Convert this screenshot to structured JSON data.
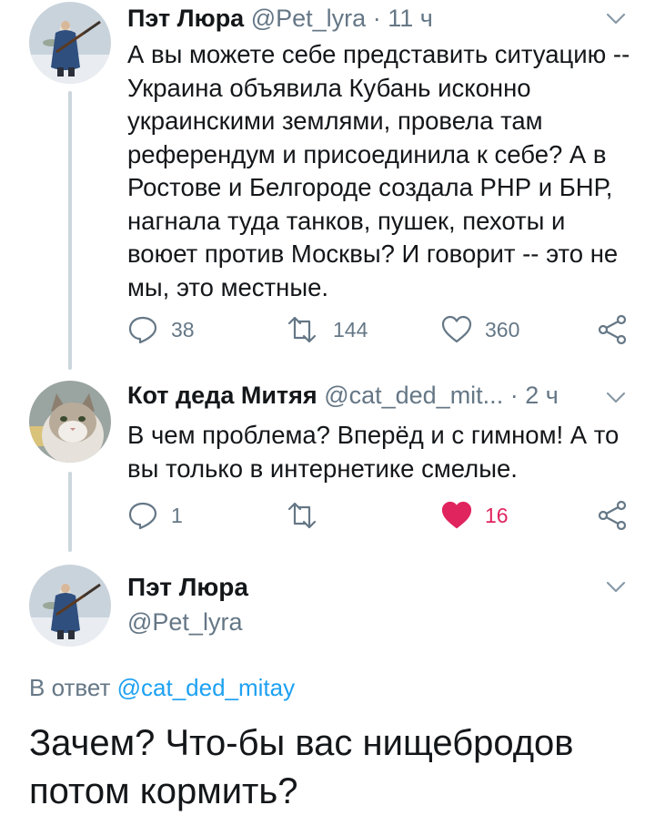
{
  "tweet1": {
    "name": "Пэт Люра",
    "handle": "@Pet_lyra",
    "sep": "·",
    "time": "11 ч",
    "text": "А вы можете себе представить ситуацию -- Украина объявила Кубань исконно украинскими землями, провела там референдум и присоединила к себе? А в Ростове и Белгороде создала РНР и БНР, нагнала туда танков, пушек, пехоты и воюет против Москвы? И говорит -- это не мы, это местные.",
    "replies": "38",
    "retweets": "144",
    "likes": "360",
    "liked": false
  },
  "tweet2": {
    "name": "Кот деда Митяя",
    "handle": "@cat_ded_mit...",
    "sep": "·",
    "time": "2 ч",
    "text": "В чем проблема? Вперёд и с гимном! А то вы только в интернетике смелые.",
    "replies": "1",
    "retweets": "",
    "likes": "16",
    "liked": true
  },
  "main_tweet": {
    "name": "Пэт Люра",
    "handle": "@Pet_lyra",
    "reply_prefix": "В ответ",
    "reply_mention": "@cat_ded_mitay",
    "text": "Зачем? Что-бы вас нищебродов потом кормить?"
  },
  "colors": {
    "text": "#14171a",
    "secondary": "#657786",
    "link": "#1da1f2",
    "like": "#e0245e",
    "thread_line": "#ccd6dd"
  },
  "icons": [
    "chevron-down-icon",
    "reply-icon",
    "retweet-icon",
    "like-icon",
    "share-icon"
  ]
}
